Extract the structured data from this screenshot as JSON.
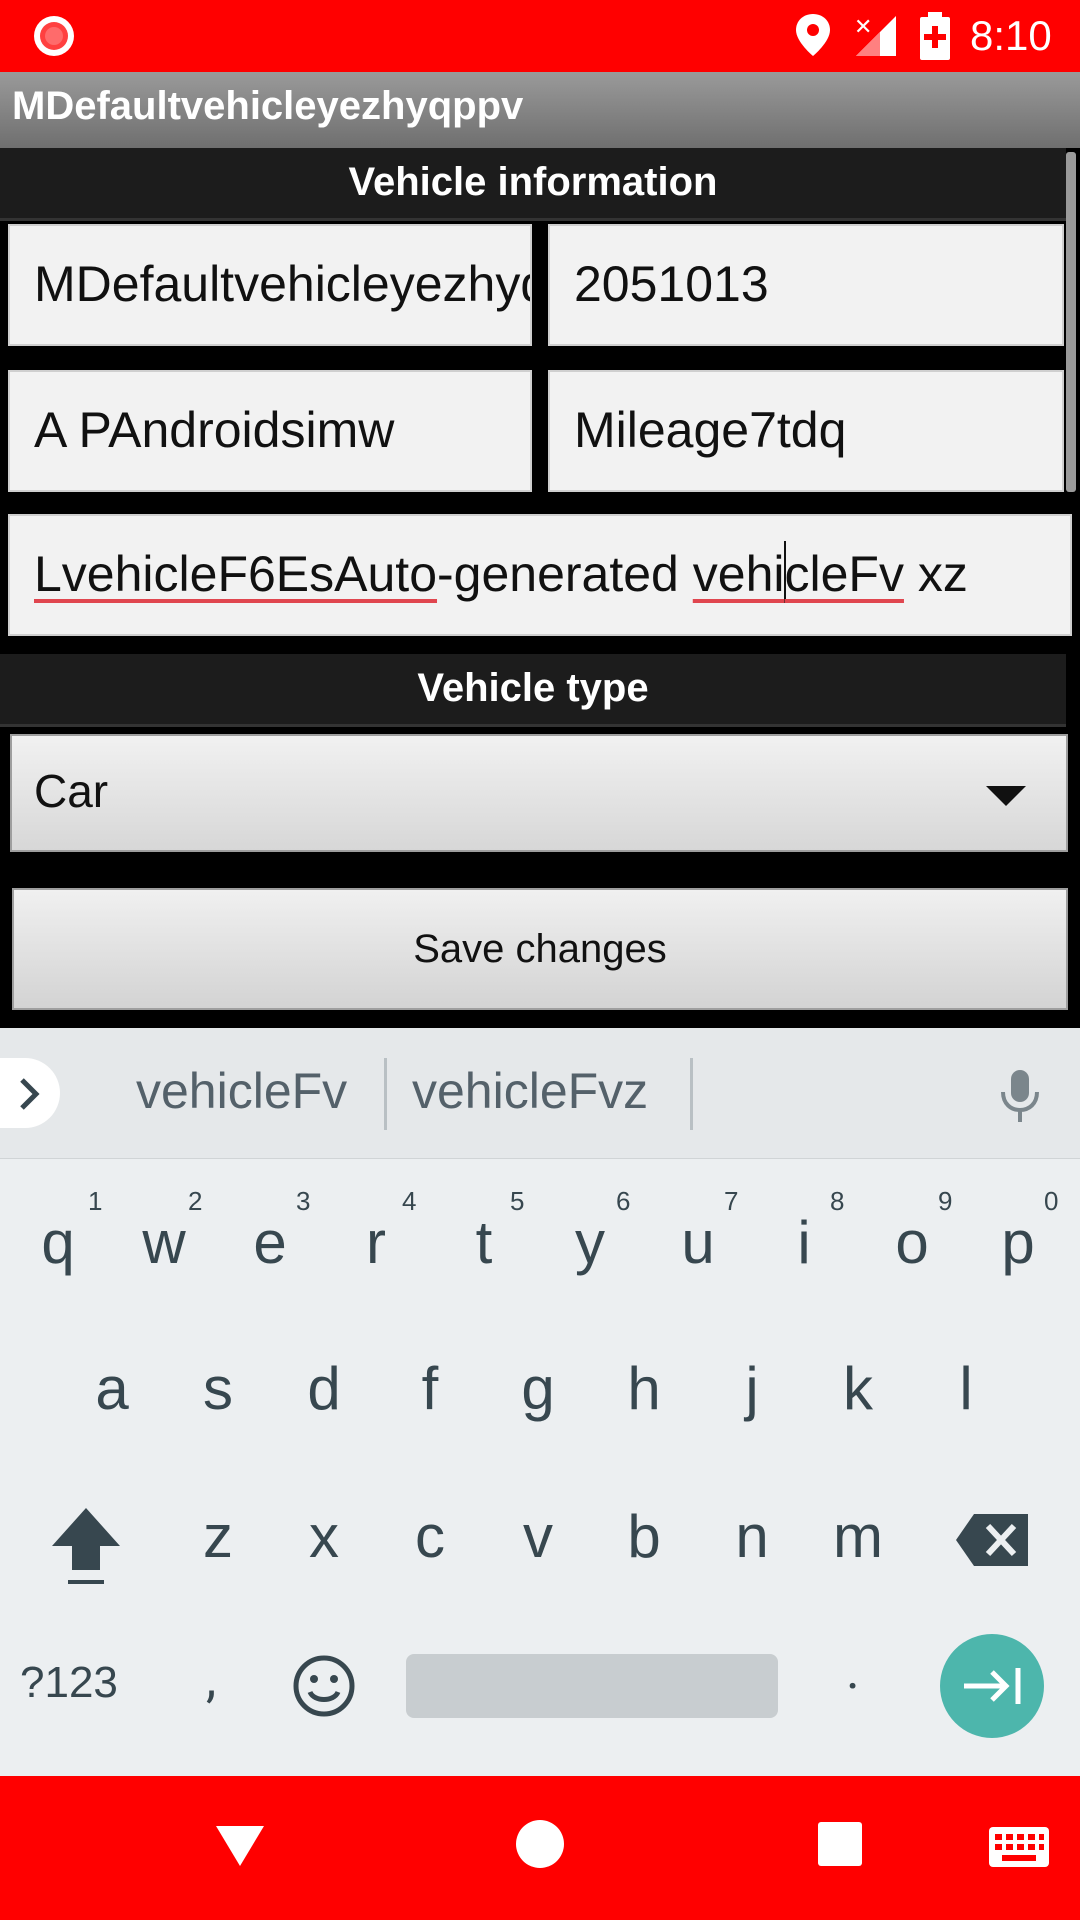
{
  "status_bar": {
    "time": "8:10",
    "icons": [
      "record-icon",
      "location-icon",
      "signal-no-data-icon",
      "battery-charging-icon"
    ]
  },
  "app_bar": {
    "title": "MDefaultvehicleyezhyqppv"
  },
  "vehicle_info": {
    "header": "Vehicle information",
    "name": "MDefaultvehicleyezhyqppv",
    "number": "2051013",
    "model": "A PAndroidsimw",
    "mileage": "Mileage7tdq",
    "notes_part1": "LvehicleF6EsAuto",
    "notes_part2": "-generated ",
    "notes_part3a": "vehi",
    "notes_part3b": "cleFv",
    "notes_part4": " xz"
  },
  "vehicle_type": {
    "header": "Vehicle type",
    "selected": "Car"
  },
  "save_button": {
    "label": "Save changes"
  },
  "keyboard": {
    "suggestions": [
      "vehicleFv",
      "vehicleFvz"
    ],
    "row1": [
      "q",
      "w",
      "e",
      "r",
      "t",
      "y",
      "u",
      "i",
      "o",
      "p"
    ],
    "row1_hints": [
      "1",
      "2",
      "3",
      "4",
      "5",
      "6",
      "7",
      "8",
      "9",
      "0"
    ],
    "row2": [
      "a",
      "s",
      "d",
      "f",
      "g",
      "h",
      "j",
      "k",
      "l"
    ],
    "row3": [
      "z",
      "x",
      "c",
      "v",
      "b",
      "n",
      "m"
    ],
    "symbols_label": "?123",
    "comma": ",",
    "period": ".",
    "accent": "#4db6ac"
  },
  "nav_bar": {
    "icons": [
      "back-icon",
      "home-icon",
      "recents-icon",
      "keyboard-switch-icon"
    ]
  },
  "colors": {
    "status_bar": "#ff0000",
    "nav_bar": "#ff0000",
    "enter_key": "#4db6ac"
  }
}
